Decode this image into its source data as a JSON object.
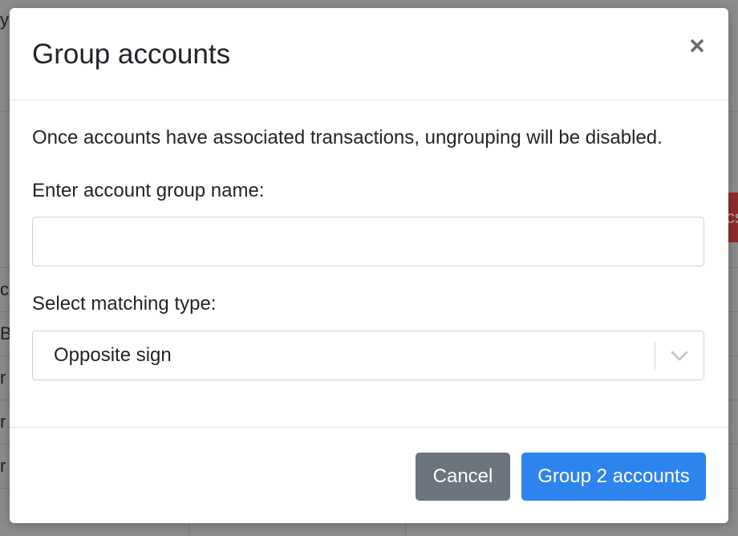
{
  "background": {
    "fragments": [
      "y",
      "c",
      "BS",
      "r",
      "r",
      "r",
      "cs"
    ]
  },
  "modal": {
    "title": "Group accounts",
    "close_icon": "close-icon",
    "info_text": "Once accounts have associated transactions, ungrouping will be disabled.",
    "name_field": {
      "label": "Enter account group name:",
      "value": "",
      "placeholder": ""
    },
    "matching_type": {
      "label": "Select matching type:",
      "selected": "Opposite sign",
      "icon": "chevron-down-icon"
    },
    "buttons": {
      "cancel": "Cancel",
      "submit": "Group 2 accounts"
    }
  },
  "colors": {
    "primary": "#2d84ec",
    "secondary": "#6c757d",
    "overlay": "#8b8b8b"
  }
}
